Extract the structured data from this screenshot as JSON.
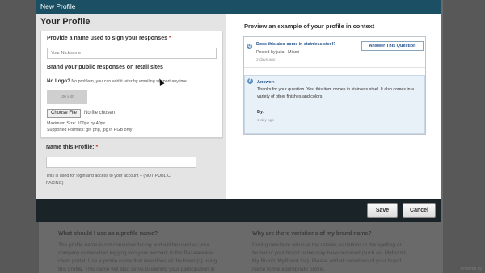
{
  "background": {
    "left_heading": "What should I use as a profile name?",
    "left_lines": [
      "The profile name is not consumer facing and will be used as your",
      "company name when logging into your account in the Bazaarvoice",
      "client portal. Use a profile name that describes all the brand(s) using",
      "this profile. This name will also serve to identify your participation in"
    ],
    "right_heading": "Why are there variations of my brand name?",
    "right_lines": [
      "During new item setup at the retailer, variations in the spelling or",
      "format of your brand name may have occurred (such as: MyBrand,",
      "My Brand, MyBrand Inc). Please add all variations of your brand",
      "name to the appropriate profile."
    ],
    "powered_by": "Powered by"
  },
  "modal": {
    "title": "New Profile",
    "heading": "Your Profile",
    "name_section": {
      "label": "Provide a name used to sign your responses",
      "required_mark": "*",
      "placeholder": "Your Nickname"
    },
    "brand_section": {
      "label": "Brand your public responses on retail sites",
      "no_logo_bold": "No Logo?",
      "no_logo_text": "No problem, you can add it later by emailing support anytime.",
      "logo_size": "100 x 40",
      "choose_file": "Choose File",
      "no_file": "No file chosen",
      "max_size": "Maximum Size: 100px by 40px",
      "formats": "Supported Formats: gif, png, jpg in RGB only"
    },
    "profile_name_section": {
      "label": "Name this Profile:",
      "required_mark": "*",
      "value": "",
      "help_line1": "This is used for login and access to your account – (NOT PUBLIC",
      "help_line2": "FACING)"
    },
    "preview": {
      "title": "Preview an example of your profile in context",
      "question": "Does this also come in stainless steel?",
      "posted_by": "Posted by julia - Miami",
      "question_age": "2 days ago",
      "answer_button": "Answer This Question",
      "answer_label": "Answer:",
      "answer_text": "Thanks for your question. Yes, this item comes in stainless steel. It also comes in a variety of other finishes and colors.",
      "by_label": "By:",
      "answer_age": "1 day ago"
    },
    "footer": {
      "save": "Save",
      "cancel": "Cancel"
    }
  }
}
